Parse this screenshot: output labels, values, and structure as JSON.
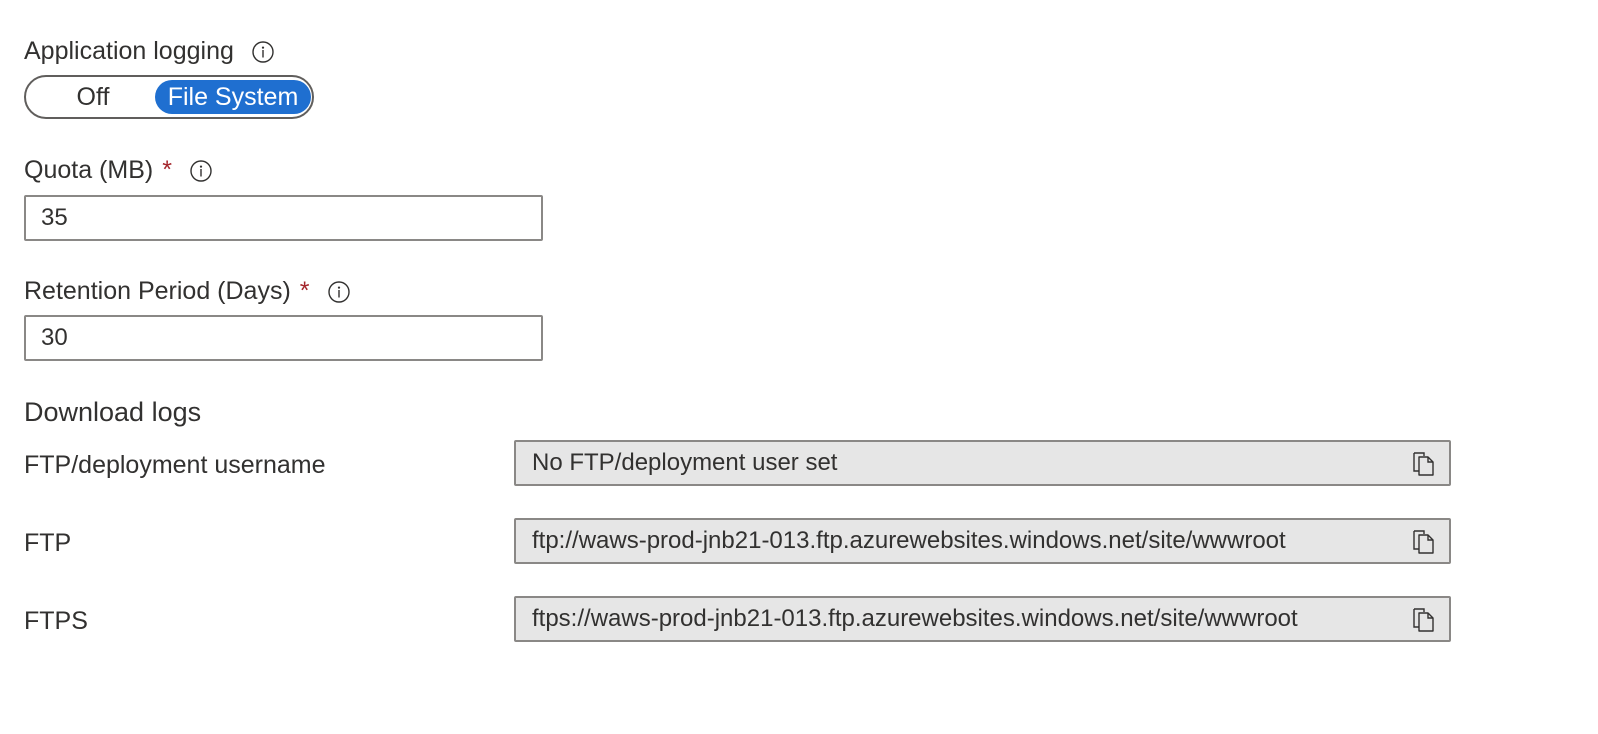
{
  "app_logging": {
    "label": "Application logging",
    "options": [
      "Off",
      "File System"
    ],
    "selected": "File System"
  },
  "quota": {
    "label": "Quota (MB)",
    "required_mark": "*",
    "value": "35"
  },
  "retention": {
    "label": "Retention Period (Days)",
    "required_mark": "*",
    "value": "30"
  },
  "download_logs": {
    "heading": "Download logs",
    "rows": [
      {
        "label": "FTP/deployment username",
        "value": "No FTP/deployment user set"
      },
      {
        "label": "FTP",
        "value": "ftp://waws-prod-jnb21-013.ftp.azurewebsites.windows.net/site/wwwroot"
      },
      {
        "label": "FTPS",
        "value": "ftps://waws-prod-jnb21-013.ftp.azurewebsites.windows.net/site/wwwroot"
      }
    ]
  },
  "icons": {
    "info": "info-icon",
    "copy": "copy-icon"
  },
  "colors": {
    "accent": "#1f6fd0",
    "required": "#a4262c",
    "readonly_bg": "#e6e6e6",
    "border": "#8a8886"
  }
}
